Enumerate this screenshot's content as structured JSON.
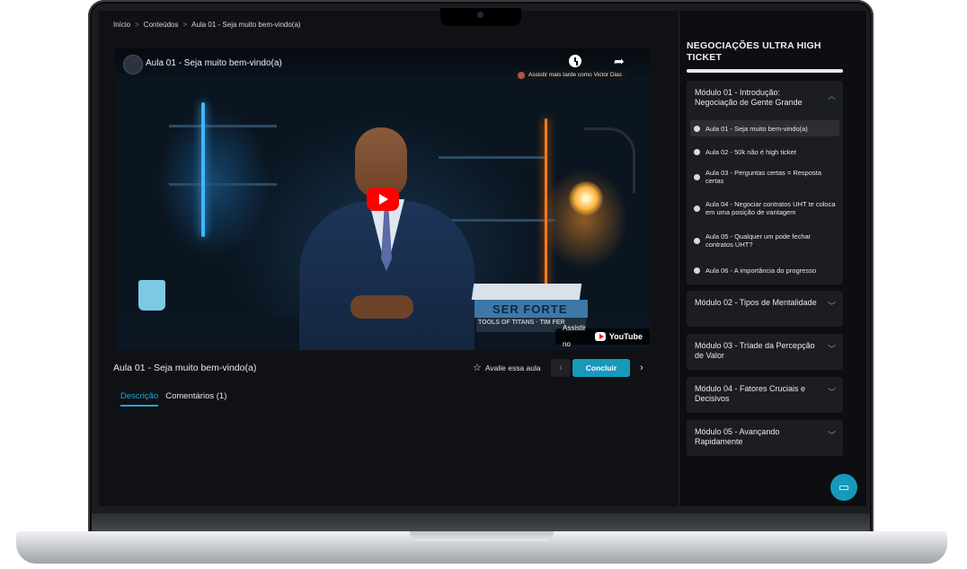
{
  "breadcrumb": {
    "items": [
      "Início",
      "Conteúdos",
      "Aula 01 - Seja muito bem-vindo(a)"
    ],
    "separator": ">"
  },
  "video": {
    "title": "Aula 01 - Seja muito bem-vindo(a)",
    "watch_later_toast": "Assistir mais tarde como Victor Dias",
    "watch_on": "Assistir no",
    "platform": "YouTube",
    "book_title": "SER FORTE",
    "book_subtitle": "TOOLS OF TITANS · TIM FER"
  },
  "lesson": {
    "title": "Aula 01 - Seja muito bem-vindo(a)",
    "rate_label": "Avalie essa aula",
    "complete_label": "Concluir"
  },
  "tabs": [
    {
      "label": "Descrição",
      "active": true
    },
    {
      "label": "Comentários (1)",
      "active": false
    }
  ],
  "course": {
    "title": "NEGOCIAÇÕES ULTRA HIGH TICKET",
    "progress": 1.0,
    "modules": [
      {
        "title": "Módulo 01 - Introdução: Negociação de Gente Grande",
        "expanded": true,
        "lessons": [
          {
            "label": "Aula 01 - Seja muito bem-vindo(a)",
            "active": true
          },
          {
            "label": "Aula 02 - 50k não é high ticket",
            "active": false
          },
          {
            "label": "Aula 03 - Perguntas certas = Resposta certas",
            "active": false
          },
          {
            "label": "Aula 04 - Negociar contratos UHT te coloca em uma posição de vantagem",
            "active": false
          },
          {
            "label": "Aula 05 - Qualquer um pode fechar contratos UHT?",
            "active": false
          },
          {
            "label": "Aula 06 - A importância do progresso",
            "active": false
          }
        ]
      },
      {
        "title": "Módulo 02 - Tipos de Mentalidade",
        "expanded": false
      },
      {
        "title": "Módulo 03 - Tríade da Percepção de Valor",
        "expanded": false
      },
      {
        "title": "Módulo 04 - Fatores Cruciais e Decisivos",
        "expanded": false
      },
      {
        "title": "Módulo 05 - Avançando Rapidamente",
        "expanded": false
      }
    ]
  },
  "colors": {
    "accent": "#1799bb",
    "background": "#101115",
    "panel": "#1b1d22"
  },
  "icons": {
    "chat": "chat-bubble-icon",
    "star": "star-outline-icon",
    "watch_later": "clock-icon",
    "share": "share-arrow-icon"
  }
}
